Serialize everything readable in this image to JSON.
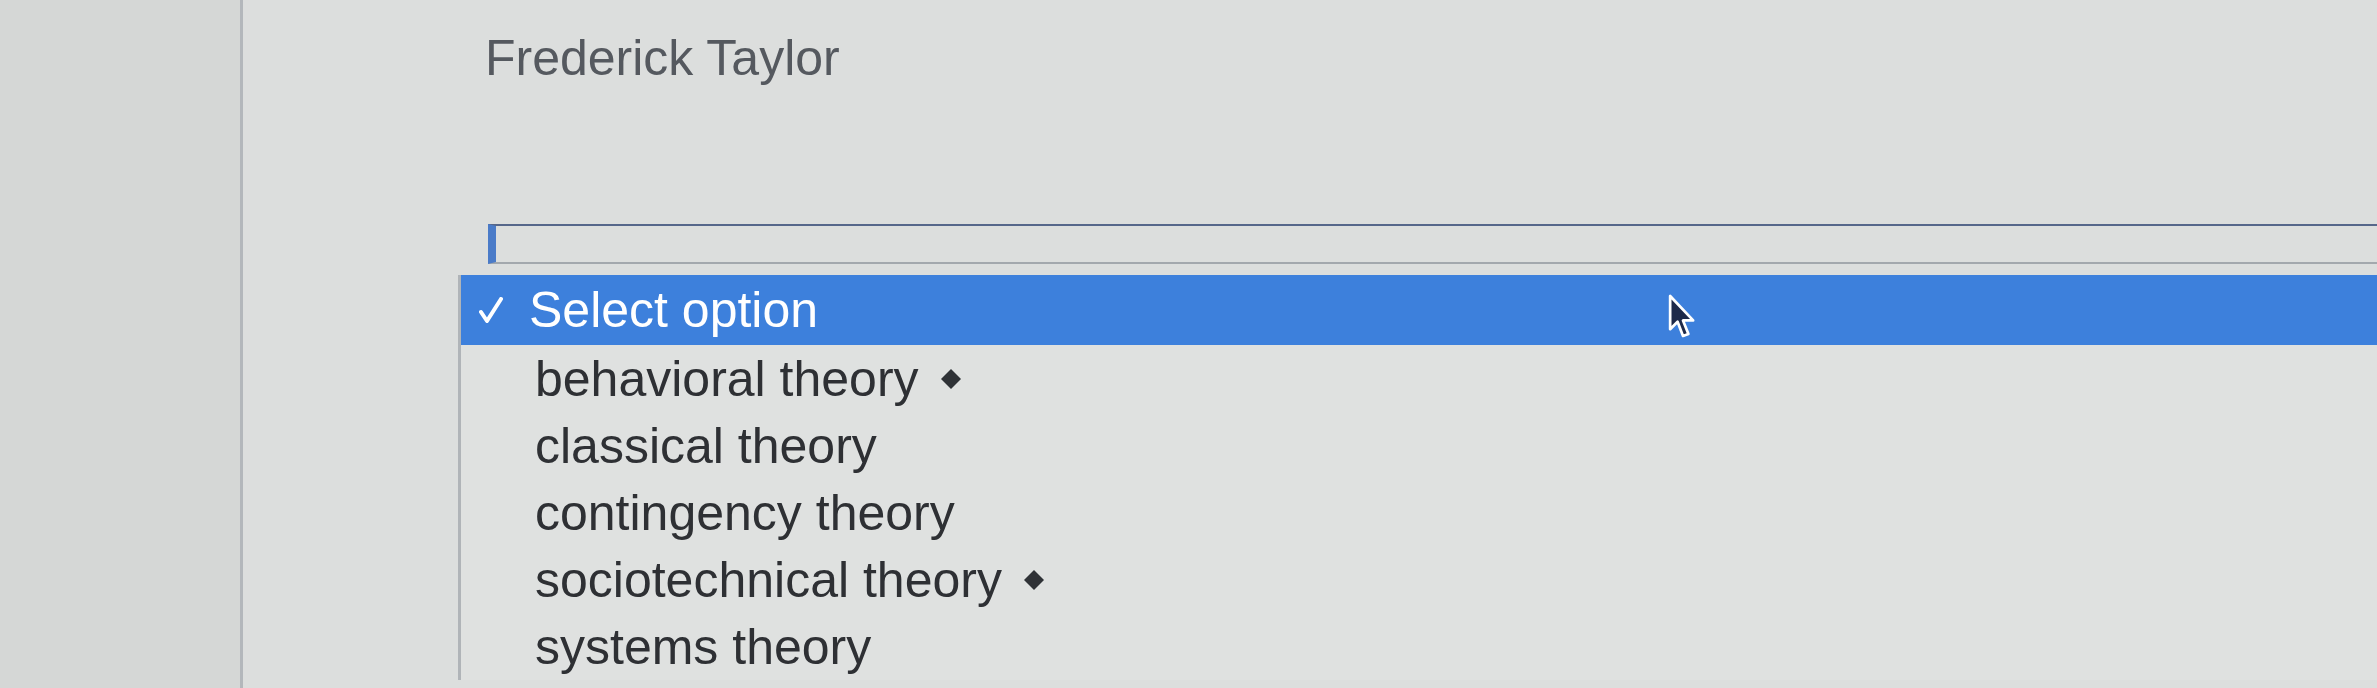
{
  "page": {
    "title": "Frederick Taylor"
  },
  "dropdown": {
    "options": [
      {
        "label": "Select option",
        "selected": true,
        "marked": false
      },
      {
        "label": "behavioral theory",
        "selected": false,
        "marked": true
      },
      {
        "label": "classical theory",
        "selected": false,
        "marked": false
      },
      {
        "label": "contingency theory",
        "selected": false,
        "marked": false
      },
      {
        "label": "sociotechnical theory",
        "selected": false,
        "marked": true
      },
      {
        "label": "systems theory",
        "selected": false,
        "marked": false
      }
    ]
  }
}
